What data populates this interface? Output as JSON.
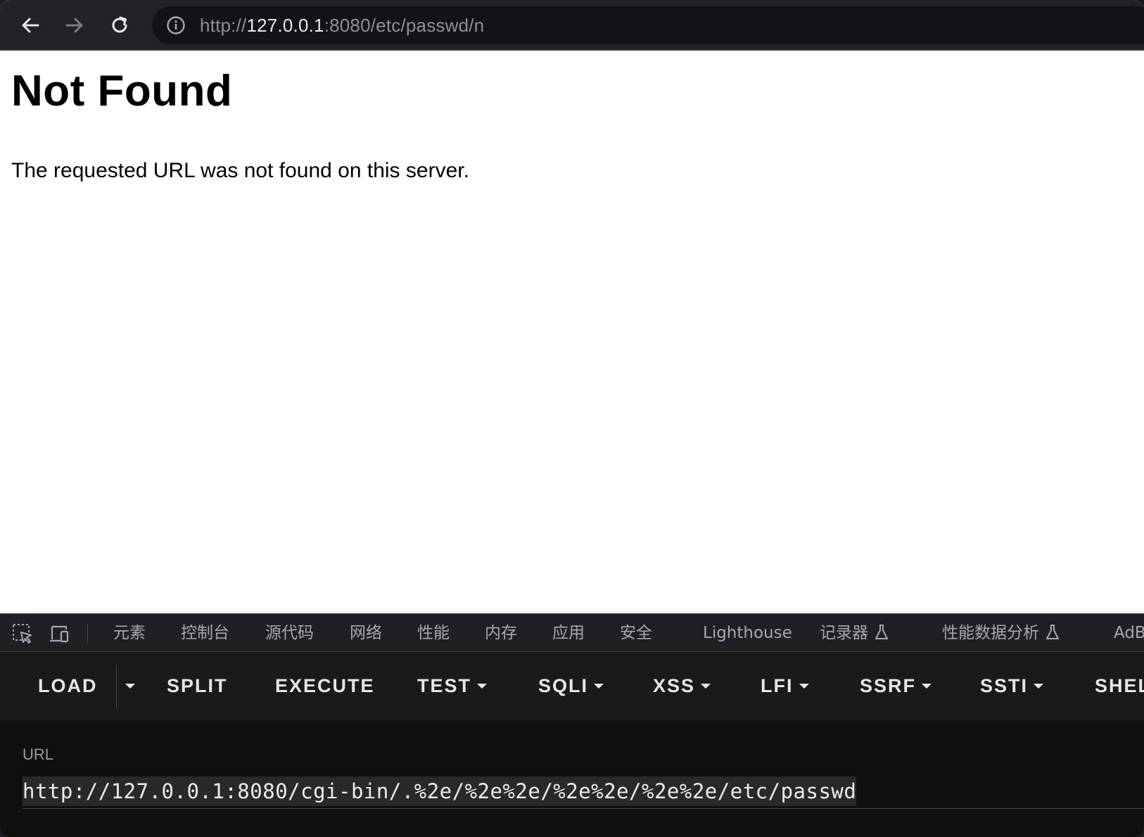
{
  "browser": {
    "url_scheme": "http://",
    "url_host": "127.0.0.1",
    "url_rest": ":8080/etc/passwd/n"
  },
  "page": {
    "heading": "Not Found",
    "message": "The requested URL was not found on this server."
  },
  "devtools": {
    "tabs": [
      "元素",
      "控制台",
      "源代码",
      "网络",
      "性能",
      "内存",
      "应用",
      "安全",
      "Lighthouse",
      "记录器",
      "性能数据分析",
      "AdB"
    ]
  },
  "hackbar": {
    "buttons": [
      "LOAD",
      "SPLIT",
      "EXECUTE",
      "TEST",
      "SQLI",
      "XSS",
      "LFI",
      "SSRF",
      "SSTI",
      "SHEL"
    ],
    "url_label": "URL",
    "url_value": "http://127.0.0.1:8080/cgi-bin/.%2e/%2e%2e/%2e%2e/%2e%2e/etc/passwd"
  },
  "colors": {
    "toolbar_bg": "#222327",
    "omnibox_bg": "#121316",
    "devtools_bg": "#1f2023",
    "hackbar_bg": "#1a1a1b"
  }
}
